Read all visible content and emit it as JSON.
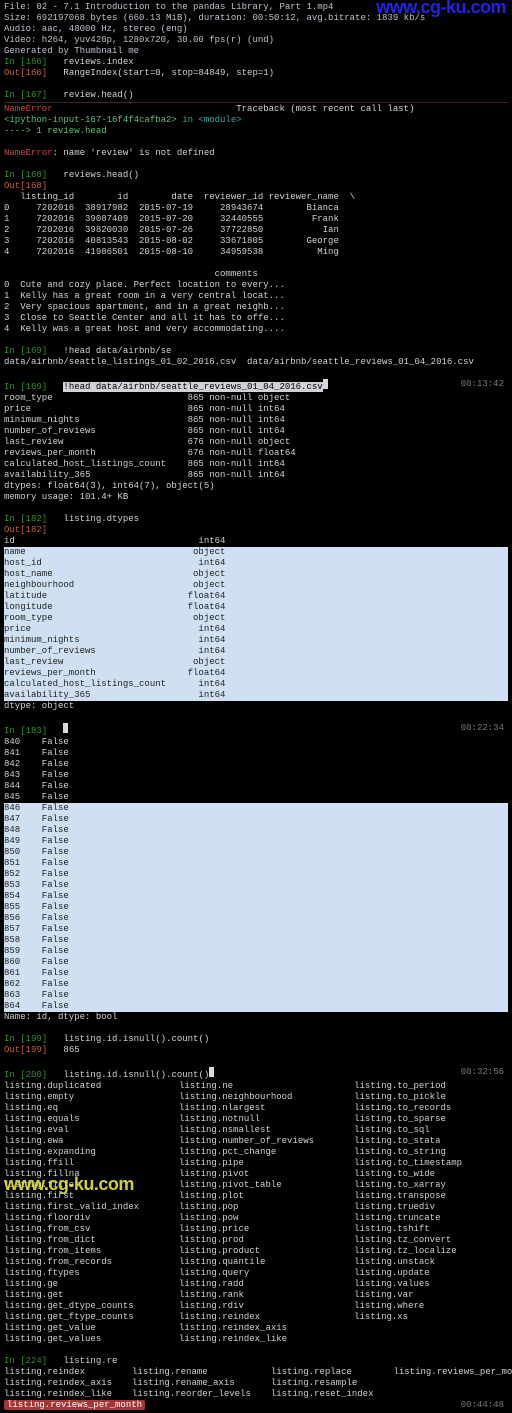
{
  "watermark_top": "www.cg-ku.com",
  "watermark_bottom": "www.cg-ku.com",
  "file_header": {
    "l1": "File: 02 - 7.1 Introduction to the pandas Library, Part 1.mp4",
    "l2": "Size: 692197068 bytes (660.13 MiB), duration: 00:50:12, avg.bitrate: 1839 kb/s",
    "l3": "Audio: aac, 48000 Hz, stereo (eng)",
    "l4": "Video: h264, yuv420p, 1280x720, 30.00 fps(r) (und)",
    "l5": "Generated by Thumbnail me"
  },
  "c166": {
    "in": "In [166]",
    "code": "reviews.index",
    "out": "Out[166]",
    "val": "RangeIndex(start=0, stop=84849, step=1)"
  },
  "c167": {
    "in": "In [167]",
    "code": "review.head()"
  },
  "traceback": {
    "line": "NameError                                  Traceback (most recent call last)",
    "file": "<ipython-input-167-16f4f4cafba2>",
    "rest": " in <module>",
    "arrow": "----> 1 review.head",
    "err_name": "NameError",
    "err_msg": ": name 'review' is not defined"
  },
  "c168": {
    "in": "In [168]",
    "code": "reviews.head()",
    "out": "Out[168]"
  },
  "table": {
    "hdr": "   listing_id        id        date  reviewer_id reviewer_name  \\",
    "rows": [
      "0     7202016  38917982  2015-07-19     28943674        Bianca",
      "1     7202016  39087409  2015-07-20     32440555         Frank",
      "2     7202016  39820030  2015-07-26     37722850           Ian",
      "3     7202016  40813543  2015-08-02     33671805        George",
      "4     7202016  41986501  2015-08-10     34959538          Ming"
    ],
    "comments_hdr": "                                       comments",
    "comments": [
      "0  Cute and cozy place. Perfect location to every...",
      "1  Kelly has a great room in a very central locat...",
      "2  Very spacious apartment, and in a great neighb...",
      "3  Close to Seattle Center and all it has to offe...",
      "4  Kelly was a great host and very accommodating...."
    ]
  },
  "c169": {
    "in": "In [169]",
    "cmd": "!head data/airbnb/se",
    "path": "data/airbnb/seattle_listings_01_02_2016.csv  data/airbnb/seattle_reviews_01_04_2016.csv",
    "code": "!head data/airbnb/seattle_reviews_01_04_2016.csv"
  },
  "ts1": "00:13:42",
  "info": [
    "room_type                         865 non-null object",
    "price                             865 non-null int64",
    "minimum_nights                    865 non-null int64",
    "number_of_reviews                 865 non-null int64",
    "last_review                       676 non-null object",
    "reviews_per_month                 676 non-null float64",
    "calculated_host_listings_count    865 non-null int64",
    "availability_365                  865 non-null int64",
    "dtypes: float64(3), int64(7), object(5)",
    "memory usage: 101.4+ KB"
  ],
  "c182": {
    "in": "In [182]",
    "code": "listing.dtypes",
    "out": "Out[182]"
  },
  "dtypes_top": "id                                  int64",
  "dtypes_sel": [
    "name                               object",
    "host_id                             int64",
    "host_name                          object",
    "neighbourhood                      object",
    "latitude                          float64",
    "longitude                         float64",
    "room_type                          object",
    "price                               int64",
    "minimum_nights                      int64",
    "number_of_reviews                   int64",
    "last_review                        object",
    "reviews_per_month                 float64",
    "calculated_host_listings_count      int64",
    "availability_365                    int64"
  ],
  "dtypes_foot": "dtype: object",
  "c183": {
    "in": "In [183]"
  },
  "ts2": "00:22:34",
  "b1": [
    "840    False",
    "841    False",
    "842    False",
    "843    False",
    "844    False",
    "845    False"
  ],
  "b2": [
    "846    False",
    "847    False",
    "848    False",
    "849    False",
    "850    False",
    "851    False",
    "852    False",
    "853    False",
    "854    False",
    "855    False",
    "856    False",
    "857    False",
    "858    False",
    "859    False",
    "860    False",
    "861    False",
    "862    False",
    "863    False",
    "864    False"
  ],
  "bfoot": "Name: id, dtype: bool",
  "c199": {
    "in": "In [199]",
    "code": "listing.id.isnull().count()",
    "out": "Out[199]",
    "val": "865"
  },
  "c200": {
    "in": "In [200]",
    "code": "listing.id.isnull().count()"
  },
  "ts3": "00:32:56",
  "ac": {
    "col1": [
      "listing.duplicated",
      "listing.empty",
      "listing.eq",
      "listing.equals",
      "listing.eval",
      "listing.ewa",
      "listing.expanding",
      "listing.ffill",
      "listing.fillna",
      "listing.filter",
      "listing.first",
      "listing.first_valid_index",
      "listing.floordiv",
      "listing.from_csv",
      "listing.from_dict",
      "listing.from_items",
      "listing.from_records",
      "listing.ftypes",
      "listing.ge",
      "listing.get",
      "listing.get_dtype_counts",
      "listing.get_ftype_counts",
      "listing.get_value",
      "listing.get_values"
    ],
    "col2": [
      "listing.ne",
      "listing.neighbourhood",
      "listing.nlargest",
      "listing.notnull",
      "listing.nsmallest",
      "listing.number_of_reviews",
      "listing.pct_change",
      "listing.pipe",
      "listing.pivot",
      "listing.pivot_table",
      "listing.plot",
      "listing.pop",
      "listing.pow",
      "listing.price",
      "listing.prod",
      "listing.product",
      "listing.quantile",
      "listing.query",
      "listing.radd",
      "listing.rank",
      "listing.rdiv",
      "listing.reindex",
      "listing.reindex_axis",
      "listing.reindex_like"
    ],
    "col3": [
      "listing.to_period",
      "listing.to_pickle",
      "listing.to_records",
      "listing.to_sparse",
      "listing.to_sql",
      "listing.to_stata",
      "listing.to_string",
      "listing.to_timestamp",
      "listing.to_wide",
      "listing.to_xarray",
      "listing.transpose",
      "listing.truediv",
      "listing.truncate",
      "listing.tshift",
      "listing.tz_convert",
      "listing.tz_localize",
      "listing.unstack",
      "listing.update",
      "listing.values",
      "listing.var",
      "listing.where",
      "listing.xs"
    ]
  },
  "c224": {
    "in": "In [224]",
    "code": "listing.re"
  },
  "ac2": {
    "col1": [
      "listing.reindex",
      "listing.reindex_axis",
      "listing.reindex_like"
    ],
    "col2": [
      "listing.rename",
      "listing.rename_axis",
      "listing.reorder_levels"
    ],
    "col3": [
      "listing.replace",
      "listing.resample",
      "listing.reset_index"
    ],
    "col4": [
      "listing.reviews_per_month"
    ]
  },
  "ts4": "00:44:48"
}
